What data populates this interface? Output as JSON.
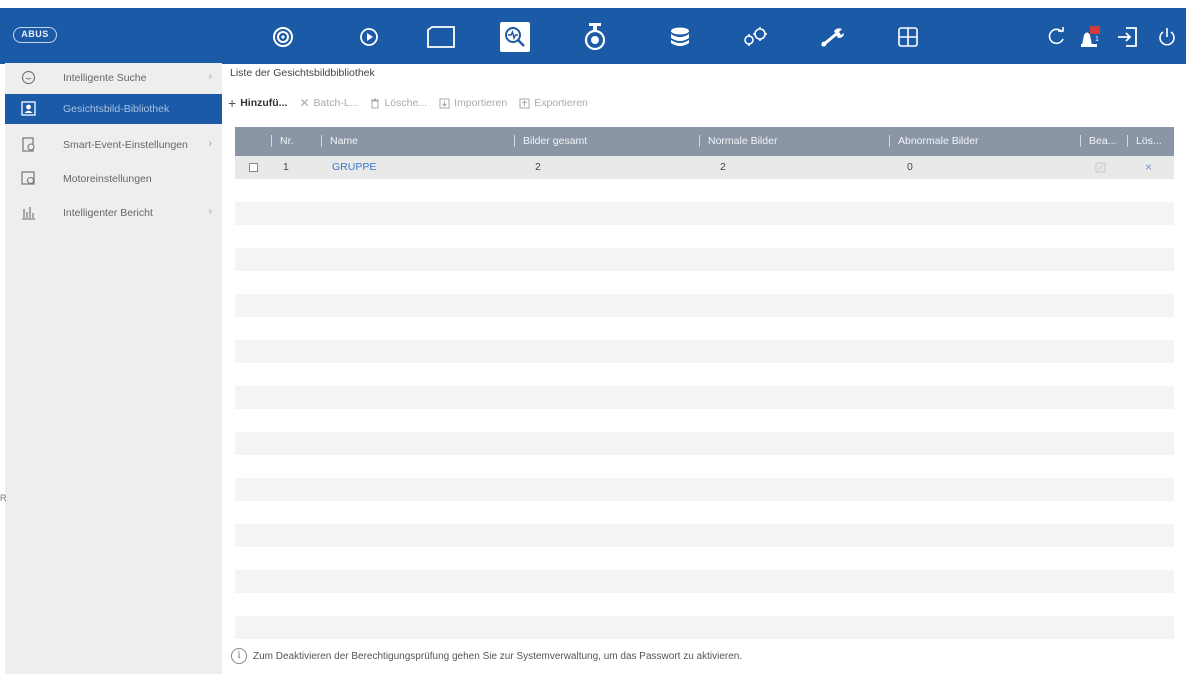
{
  "brand": {
    "logo_text": "ABUS"
  },
  "topnav": {
    "icons": [
      "live-view-icon",
      "playback-icon",
      "files-icon",
      "smart-search-icon",
      "camera-icon",
      "storage-icon",
      "config-icon",
      "maintenance-wrench-icon",
      "multiview-icon"
    ],
    "active": "smart-search-icon",
    "right_icons": [
      "refresh-icon",
      "alarm-icon",
      "logout-icon",
      "power-icon"
    ],
    "alarm_badge": "1"
  },
  "sidebar": {
    "items": [
      {
        "label": "Intelligente Suche",
        "icon": "search-face-icon",
        "arrow": "›"
      },
      {
        "label": "Gesichtsbild-Bibliothek",
        "icon": "face-library-icon",
        "arrow": "",
        "selected": true
      },
      {
        "label": "Smart-Event-Einstellungen",
        "icon": "event-settings-icon",
        "arrow": "›"
      },
      {
        "label": "Motoreinstellungen",
        "icon": "engine-settings-icon",
        "arrow": ""
      },
      {
        "label": "Intelligenter Bericht",
        "icon": "report-chart-icon",
        "arrow": "›"
      }
    ],
    "edge_char": "R"
  },
  "main": {
    "title": "Liste der Gesichtsbildbibliothek",
    "toolbar": {
      "add": "Hinzufü...",
      "batch": "Batch-L...",
      "delete": "Lösche...",
      "import": "Importieren",
      "export": "Exportieren"
    },
    "table": {
      "headers": {
        "nr": "Nr.",
        "name": "Name",
        "total": "Bilder gesamt",
        "normal": "Normale Bilder",
        "abnormal": "Abnormale Bilder",
        "edit": "Bea...",
        "del": "Lös..."
      },
      "rows": [
        {
          "nr": "1",
          "name": "GRUPPE",
          "total": "2",
          "normal": "2",
          "abnormal": "0",
          "delete_glyph": "×"
        }
      ]
    },
    "footer_note": "Zum Deaktivieren der Berechtigungsprüfung gehen Sie zur Systemverwaltung, um das Passwort zu aktivieren."
  },
  "colors": {
    "topbar": "#1a5aa6",
    "header": "#8a96a6",
    "link": "#3c78c8",
    "sidebar": "#eeeeee"
  }
}
